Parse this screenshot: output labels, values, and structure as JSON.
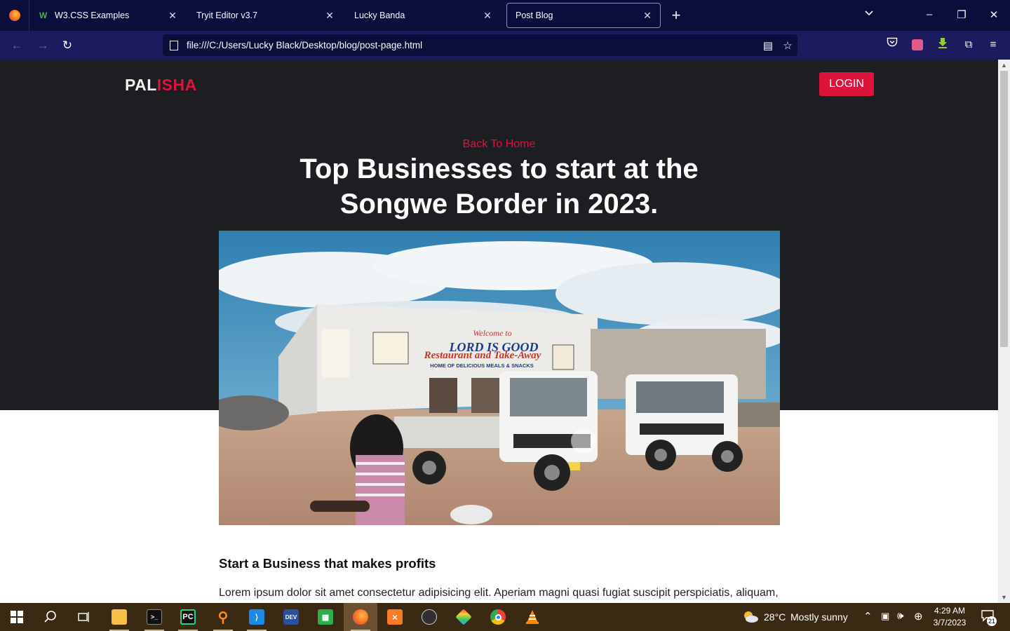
{
  "browser": {
    "tabs": [
      {
        "title": "W3.CSS Examples",
        "icon": "w3schools-icon",
        "active": false
      },
      {
        "title": "Tryit Editor v3.7",
        "icon": "",
        "active": false
      },
      {
        "title": "Lucky Banda",
        "icon": "",
        "active": false
      },
      {
        "title": "Post Blog",
        "icon": "",
        "active": true
      }
    ],
    "url": "file:///C:/Users/Lucky Black/Desktop/blog/post-page.html"
  },
  "site": {
    "brand_part1": "PAL",
    "brand_part2": "ISHA",
    "login_label": "LOGIN",
    "back_link": "Back To Home",
    "title_line1": "Top Businesses to start at the",
    "title_line2": "Songwe Border in 2023.",
    "section_heading": "Start a Business that makes profits",
    "paragraph": "Lorem ipsum dolor sit amet consectetur adipisicing elit. Aperiam magni quasi fugiat suscipit perspiciatis, aliquam,",
    "image_sign": {
      "welcome": "Welcome to",
      "name": "LORD IS GOOD",
      "line2": "Restaurant and Take-Away",
      "line3": "HOME OF DELICIOUS MEALS & SNACKS"
    },
    "accent_color": "#dc143c"
  },
  "taskbar": {
    "weather_temp": "28°C",
    "weather_text": "Mostly sunny",
    "time": "4:29 AM",
    "date": "3/7/2023",
    "notifications": "21"
  }
}
